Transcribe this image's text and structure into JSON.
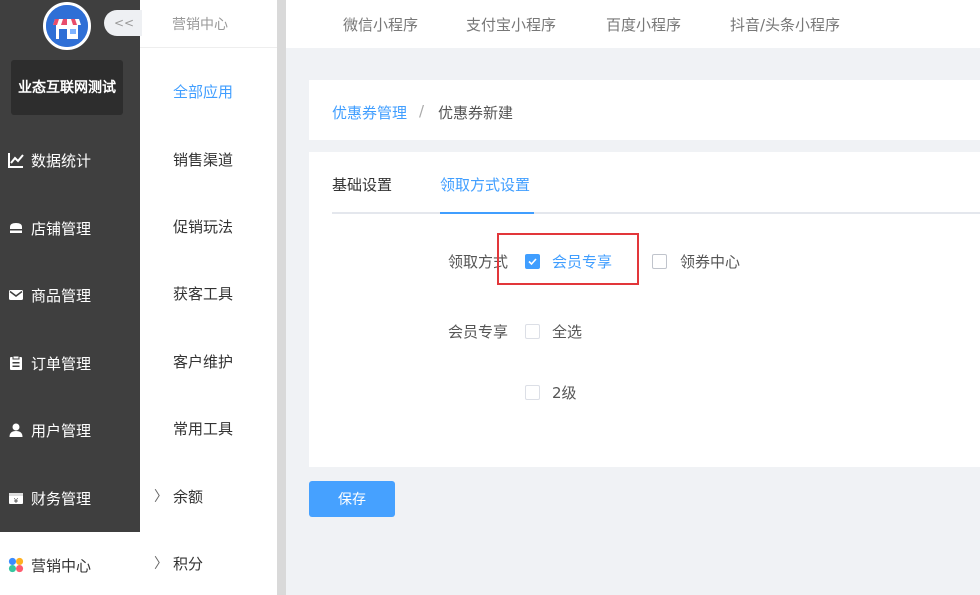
{
  "sidebar": {
    "shop_name": "业态互联网测试",
    "items": [
      {
        "label": "数据统计",
        "icon": "chart-line-icon"
      },
      {
        "label": "店铺管理",
        "icon": "store-icon"
      },
      {
        "label": "商品管理",
        "icon": "mail-icon"
      },
      {
        "label": "订单管理",
        "icon": "clipboard-icon"
      },
      {
        "label": "用户管理",
        "icon": "user-icon"
      },
      {
        "label": "财务管理",
        "icon": "yen-box-icon"
      },
      {
        "label": "营销中心",
        "icon": "marketing-colorful-icon",
        "active": true
      }
    ]
  },
  "subnav": {
    "title": "营销中心",
    "collapse": "<<",
    "items": [
      "全部应用",
      "销售渠道",
      "促销玩法",
      "获客工具",
      "客户维护",
      "常用工具",
      "余额",
      "积分"
    ],
    "arrow": "〉"
  },
  "top_tabs": [
    "微信小程序",
    "支付宝小程序",
    "百度小程序",
    "抖音/头条小程序"
  ],
  "breadcrumb": {
    "parent": "优惠券管理",
    "separator": "/",
    "current": "优惠券新建"
  },
  "tabs": {
    "basic": "基础设置",
    "claim": "领取方式设置"
  },
  "form": {
    "claim_label": "领取方式",
    "option_member": "会员专享",
    "option_center": "领券中心",
    "member_label": "会员专享",
    "select_all": "全选",
    "level2": "2级"
  },
  "save_label": "保存",
  "colors": {
    "accent": "#409eff",
    "sidebar": "#3f3f3f",
    "highlight": "#e2363a"
  }
}
